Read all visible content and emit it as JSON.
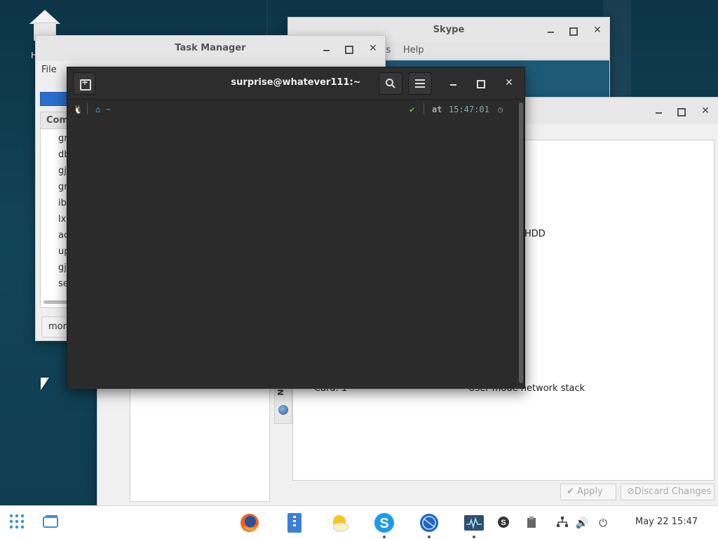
{
  "desktop": {
    "icon_label": "H"
  },
  "skype": {
    "title": "Skype",
    "menu_partial_1": "ls",
    "menu_help": "Help"
  },
  "task_manager": {
    "title": "Task Manager",
    "menu_file": "File",
    "column_header": "Com",
    "processes": [
      "gr",
      "db",
      "gj",
      "gr",
      "ib",
      "lxt",
      "ac",
      "up",
      "gj",
      "se"
    ],
    "more_button": "mor"
  },
  "terminal": {
    "title": "surprise@whatever111:~",
    "prompt": {
      "os_icon": "linux-icon",
      "dir": "~",
      "status": "✔",
      "at": "at",
      "time": "15:47:01"
    }
  },
  "network_window": {
    "hdd_text": "HDD",
    "tab_label": "Ne",
    "row_card": "Card: 1",
    "row_desc": "User mode network stack",
    "apply_button": "Apply",
    "discard_button": "Discard Changes"
  },
  "taskbar": {
    "apps": [
      "firefox-icon",
      "file-manager-icon",
      "weather-icon",
      "skype-icon",
      "network-globe-icon",
      "system-monitor-icon"
    ],
    "tray": [
      "skype-tray-icon",
      "clipboard-icon",
      "network-icon",
      "volume-icon",
      "power-icon"
    ],
    "clock": "May 22  15:47"
  },
  "colors": {
    "accent": "#2a6fd0",
    "terminal_bg": "#2b2b2b",
    "desktop_bg": "#124458",
    "prompt_blue": "#4a9fd8",
    "prompt_green": "#7bbf3a"
  }
}
